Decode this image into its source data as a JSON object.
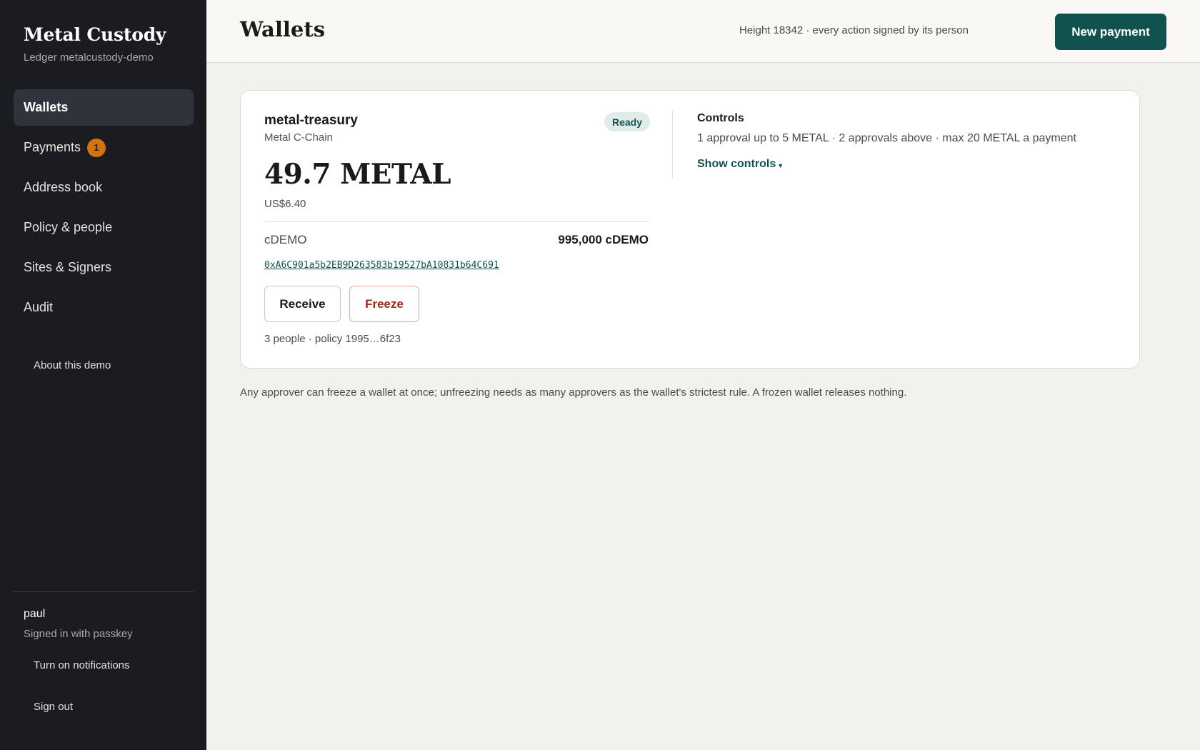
{
  "app": {
    "name": "Metal Custody",
    "ledger": "Ledger metalcustody-demo"
  },
  "sidebar": {
    "items": [
      {
        "label": "Wallets",
        "active": true
      },
      {
        "label": "Payments",
        "badge": "1"
      },
      {
        "label": "Address book"
      },
      {
        "label": "Policy & people"
      },
      {
        "label": "Sites & Signers"
      },
      {
        "label": "Audit"
      }
    ],
    "about": "About this demo",
    "user": {
      "name": "paul",
      "status": "Signed in with passkey"
    },
    "notifications": "Turn on notifications",
    "sign_out": "Sign out"
  },
  "header": {
    "title": "Wallets",
    "status": "Height 18342 · every action signed by its person",
    "new_payment": "New payment"
  },
  "wallet": {
    "name": "metal-treasury",
    "chain": "Metal C-Chain",
    "status": "Ready",
    "balance": "49.7 METAL",
    "fiat": "US$6.40",
    "token": {
      "name": "cDEMO",
      "amount": "995,000 cDEMO",
      "address": "0xA6C901a5b2EB9D263583b19527bA10831b64C691"
    },
    "actions": {
      "receive": "Receive",
      "freeze": "Freeze"
    },
    "policy_line": "3 people · policy 1995…6f23",
    "controls": {
      "title": "Controls",
      "description": "1 approval up to 5 METAL · 2 approvals above · max 20 METAL a payment",
      "toggle": "Show controls"
    }
  },
  "footnote": "Any approver can freeze a wallet at once; unfreezing needs as many approvers as the wallet's strictest rule. A frozen wallet releases nothing.",
  "colors": {
    "sidebar_bg": "#1a1c22",
    "accent": "#11524f",
    "badge": "#d2730f",
    "danger": "#9b2a1a"
  }
}
